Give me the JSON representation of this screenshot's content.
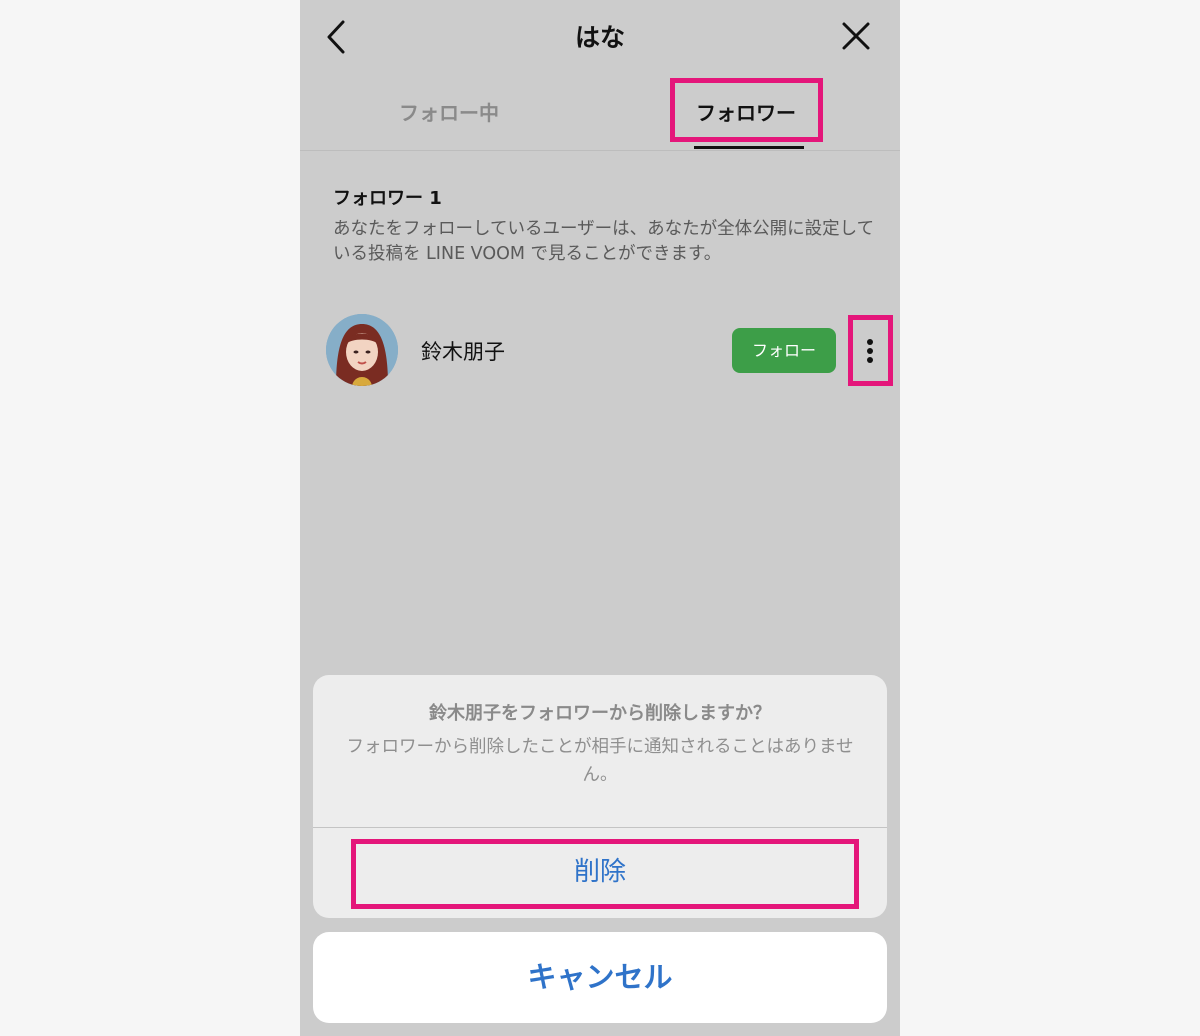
{
  "header": {
    "title": "はな"
  },
  "tabs": [
    {
      "label": "フォロー中",
      "selected": false
    },
    {
      "label": "フォロワー",
      "selected": true
    }
  ],
  "section": {
    "title": "フォロワー 1",
    "description": "あなたをフォローしているユーザーは、あなたが全体公開に設定している投稿を LINE VOOM で見ることができます。"
  },
  "followers": [
    {
      "name": "鈴木朋子",
      "follow_label": "フォロー"
    }
  ],
  "dialog": {
    "title": "鈴木朋子をフォロワーから削除しますか？",
    "message": "フォロワーから削除したことが相手に通知されることはありません。",
    "delete_label": "削除",
    "cancel_label": "キャンセル"
  },
  "colors": {
    "highlight": "#e4167a",
    "follow_button": "#3d9e48",
    "action_text": "#2f73c9"
  }
}
